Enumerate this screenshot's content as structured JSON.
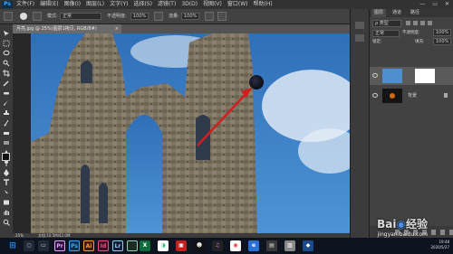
{
  "app": {
    "logo_text": "Ps"
  },
  "menubar": {
    "items": [
      "文件(F)",
      "编辑(E)",
      "图像(I)",
      "图层(L)",
      "文字(Y)",
      "选择(S)",
      "滤镜(T)",
      "3D(D)",
      "视图(V)",
      "窗口(W)",
      "帮助(H)"
    ],
    "window_buttons": [
      "—",
      "▭",
      "✕"
    ]
  },
  "options": {
    "mode_label": "模式:",
    "mode_value": "正常",
    "opacity_label": "不透明度:",
    "opacity_value": "100%",
    "flow_label": "流量:",
    "flow_value": "100%"
  },
  "document": {
    "tab_title": "月亮.jpg @ 25%(图层1拷贝, RGB/8#)",
    "close": "×"
  },
  "status": {
    "zoom": "25%",
    "doc_info": "文档:10.5M/42.0M"
  },
  "layers_panel": {
    "tabs": [
      "图层",
      "通道",
      "路径"
    ],
    "kind_label": "ρ 类型",
    "blend_mode": "正常",
    "opacity_label": "不透明度:",
    "opacity_value": "100%",
    "lock_label": "锁定:",
    "fill_label": "填充:",
    "fill_value": "100%",
    "layers": [
      {
        "name": "",
        "visible": true
      },
      {
        "name": "背景",
        "visible": true
      }
    ]
  },
  "watermark": {
    "brand": "Bai",
    "brand2": "经验",
    "url": "jingyan.baidu.com"
  },
  "taskbar": {
    "apps": [
      {
        "icon": "premiere-icon",
        "label": "Pr",
        "color": "#2a0f3f",
        "fg": "#e4a5ff"
      },
      {
        "icon": "photoshop-icon",
        "label": "Ps",
        "color": "#0b2e4a",
        "fg": "#39a9ff"
      },
      {
        "icon": "illustrator-icon",
        "label": "Ai",
        "color": "#3b1b05",
        "fg": "#ff9a2c"
      },
      {
        "icon": "indesign-icon",
        "label": "Id",
        "color": "#3b0b1f",
        "fg": "#ff4a8a"
      },
      {
        "icon": "lightroom-icon",
        "label": "Lr",
        "color": "#0a2030",
        "fg": "#8ad1ff"
      },
      {
        "icon": "media-encoder-icon",
        "label": "",
        "color": "#1d2b24",
        "fg": "#8fd3a9"
      }
    ],
    "clock_time": "19:48",
    "clock_date": "2020/5/27"
  },
  "colors": {
    "sky": "#3a7fc6",
    "stone": "#7a7160",
    "moon": "#10121c",
    "arrow": "#d31e1e"
  }
}
